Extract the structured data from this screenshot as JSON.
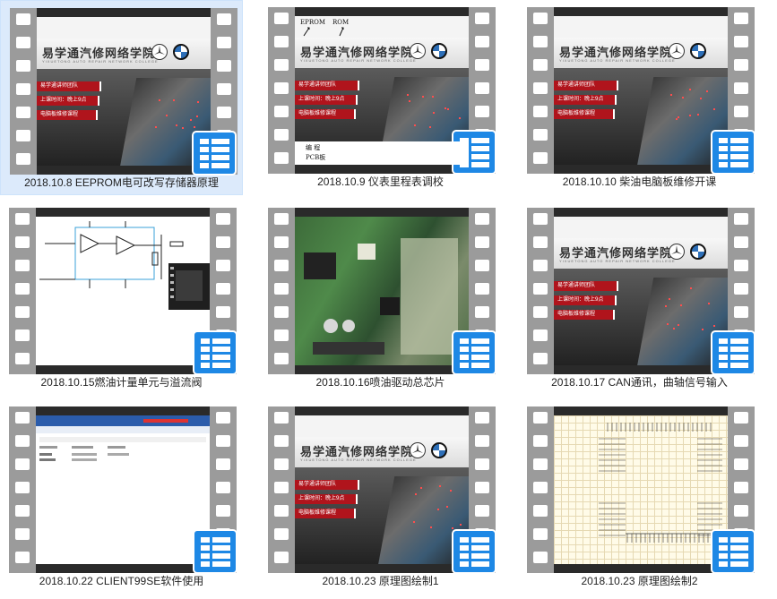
{
  "items": [
    {
      "caption": "2018.10.8 EEPROM电可改写存储器原理",
      "selected": true,
      "thumb": "banner"
    },
    {
      "caption": "2018.10.9 仪表里程表调校",
      "selected": false,
      "thumb": "banner-labels",
      "labels": [
        "EPROM",
        "ROM",
        "编  程",
        "PCB板"
      ]
    },
    {
      "caption": "2018.10.10 柴油电脑板维修开课",
      "selected": false,
      "thumb": "banner"
    },
    {
      "caption": "2018.10.15燃油计量单元与溢流阀",
      "selected": false,
      "thumb": "schematic"
    },
    {
      "caption": "2018.10.16喷油驱动总芯片",
      "selected": false,
      "thumb": "pcb"
    },
    {
      "caption": "2018.10.17 CAN通讯，曲轴信号输入",
      "selected": false,
      "thumb": "banner"
    },
    {
      "caption": "2018.10.22 CLIENT99SE软件使用",
      "selected": false,
      "thumb": "software"
    },
    {
      "caption": "2018.10.23 原理图绘制1",
      "selected": false,
      "thumb": "banner"
    },
    {
      "caption": "2018.10.23 原理图绘制2",
      "selected": false,
      "thumb": "grid"
    }
  ],
  "banner": {
    "title": "易学通汽修网络学院",
    "subtitle": "YIXUETONG AUTO REPAIR NETWORK COLLEGE",
    "tags": [
      "易学通讲师团队",
      "上课时间：晚上9点",
      "电脑板维修课程"
    ]
  },
  "icons": {
    "logo1": "mercedes-logo",
    "logo2": "bmw-logo",
    "video": "video-file-icon"
  },
  "colors": {
    "accent": "#1e88e5",
    "selection": "#dceafb",
    "film": "#9b9b9b",
    "tag": "#b0141c"
  }
}
